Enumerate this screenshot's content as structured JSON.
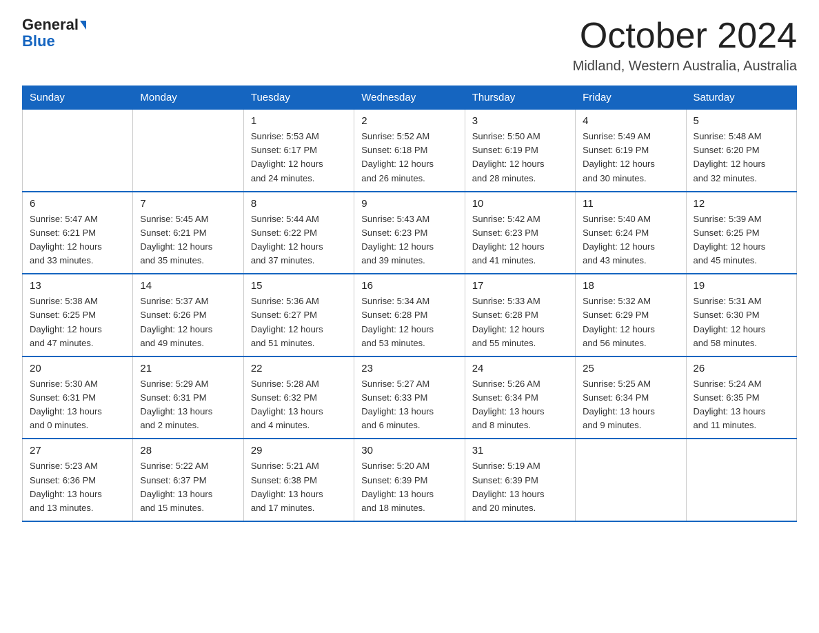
{
  "logo": {
    "general": "General",
    "blue": "Blue"
  },
  "title": "October 2024",
  "subtitle": "Midland, Western Australia, Australia",
  "weekdays": [
    "Sunday",
    "Monday",
    "Tuesday",
    "Wednesday",
    "Thursday",
    "Friday",
    "Saturday"
  ],
  "weeks": [
    [
      {
        "day": "",
        "info": ""
      },
      {
        "day": "",
        "info": ""
      },
      {
        "day": "1",
        "info": "Sunrise: 5:53 AM\nSunset: 6:17 PM\nDaylight: 12 hours\nand 24 minutes."
      },
      {
        "day": "2",
        "info": "Sunrise: 5:52 AM\nSunset: 6:18 PM\nDaylight: 12 hours\nand 26 minutes."
      },
      {
        "day": "3",
        "info": "Sunrise: 5:50 AM\nSunset: 6:19 PM\nDaylight: 12 hours\nand 28 minutes."
      },
      {
        "day": "4",
        "info": "Sunrise: 5:49 AM\nSunset: 6:19 PM\nDaylight: 12 hours\nand 30 minutes."
      },
      {
        "day": "5",
        "info": "Sunrise: 5:48 AM\nSunset: 6:20 PM\nDaylight: 12 hours\nand 32 minutes."
      }
    ],
    [
      {
        "day": "6",
        "info": "Sunrise: 5:47 AM\nSunset: 6:21 PM\nDaylight: 12 hours\nand 33 minutes."
      },
      {
        "day": "7",
        "info": "Sunrise: 5:45 AM\nSunset: 6:21 PM\nDaylight: 12 hours\nand 35 minutes."
      },
      {
        "day": "8",
        "info": "Sunrise: 5:44 AM\nSunset: 6:22 PM\nDaylight: 12 hours\nand 37 minutes."
      },
      {
        "day": "9",
        "info": "Sunrise: 5:43 AM\nSunset: 6:23 PM\nDaylight: 12 hours\nand 39 minutes."
      },
      {
        "day": "10",
        "info": "Sunrise: 5:42 AM\nSunset: 6:23 PM\nDaylight: 12 hours\nand 41 minutes."
      },
      {
        "day": "11",
        "info": "Sunrise: 5:40 AM\nSunset: 6:24 PM\nDaylight: 12 hours\nand 43 minutes."
      },
      {
        "day": "12",
        "info": "Sunrise: 5:39 AM\nSunset: 6:25 PM\nDaylight: 12 hours\nand 45 minutes."
      }
    ],
    [
      {
        "day": "13",
        "info": "Sunrise: 5:38 AM\nSunset: 6:25 PM\nDaylight: 12 hours\nand 47 minutes."
      },
      {
        "day": "14",
        "info": "Sunrise: 5:37 AM\nSunset: 6:26 PM\nDaylight: 12 hours\nand 49 minutes."
      },
      {
        "day": "15",
        "info": "Sunrise: 5:36 AM\nSunset: 6:27 PM\nDaylight: 12 hours\nand 51 minutes."
      },
      {
        "day": "16",
        "info": "Sunrise: 5:34 AM\nSunset: 6:28 PM\nDaylight: 12 hours\nand 53 minutes."
      },
      {
        "day": "17",
        "info": "Sunrise: 5:33 AM\nSunset: 6:28 PM\nDaylight: 12 hours\nand 55 minutes."
      },
      {
        "day": "18",
        "info": "Sunrise: 5:32 AM\nSunset: 6:29 PM\nDaylight: 12 hours\nand 56 minutes."
      },
      {
        "day": "19",
        "info": "Sunrise: 5:31 AM\nSunset: 6:30 PM\nDaylight: 12 hours\nand 58 minutes."
      }
    ],
    [
      {
        "day": "20",
        "info": "Sunrise: 5:30 AM\nSunset: 6:31 PM\nDaylight: 13 hours\nand 0 minutes."
      },
      {
        "day": "21",
        "info": "Sunrise: 5:29 AM\nSunset: 6:31 PM\nDaylight: 13 hours\nand 2 minutes."
      },
      {
        "day": "22",
        "info": "Sunrise: 5:28 AM\nSunset: 6:32 PM\nDaylight: 13 hours\nand 4 minutes."
      },
      {
        "day": "23",
        "info": "Sunrise: 5:27 AM\nSunset: 6:33 PM\nDaylight: 13 hours\nand 6 minutes."
      },
      {
        "day": "24",
        "info": "Sunrise: 5:26 AM\nSunset: 6:34 PM\nDaylight: 13 hours\nand 8 minutes."
      },
      {
        "day": "25",
        "info": "Sunrise: 5:25 AM\nSunset: 6:34 PM\nDaylight: 13 hours\nand 9 minutes."
      },
      {
        "day": "26",
        "info": "Sunrise: 5:24 AM\nSunset: 6:35 PM\nDaylight: 13 hours\nand 11 minutes."
      }
    ],
    [
      {
        "day": "27",
        "info": "Sunrise: 5:23 AM\nSunset: 6:36 PM\nDaylight: 13 hours\nand 13 minutes."
      },
      {
        "day": "28",
        "info": "Sunrise: 5:22 AM\nSunset: 6:37 PM\nDaylight: 13 hours\nand 15 minutes."
      },
      {
        "day": "29",
        "info": "Sunrise: 5:21 AM\nSunset: 6:38 PM\nDaylight: 13 hours\nand 17 minutes."
      },
      {
        "day": "30",
        "info": "Sunrise: 5:20 AM\nSunset: 6:39 PM\nDaylight: 13 hours\nand 18 minutes."
      },
      {
        "day": "31",
        "info": "Sunrise: 5:19 AM\nSunset: 6:39 PM\nDaylight: 13 hours\nand 20 minutes."
      },
      {
        "day": "",
        "info": ""
      },
      {
        "day": "",
        "info": ""
      }
    ]
  ]
}
